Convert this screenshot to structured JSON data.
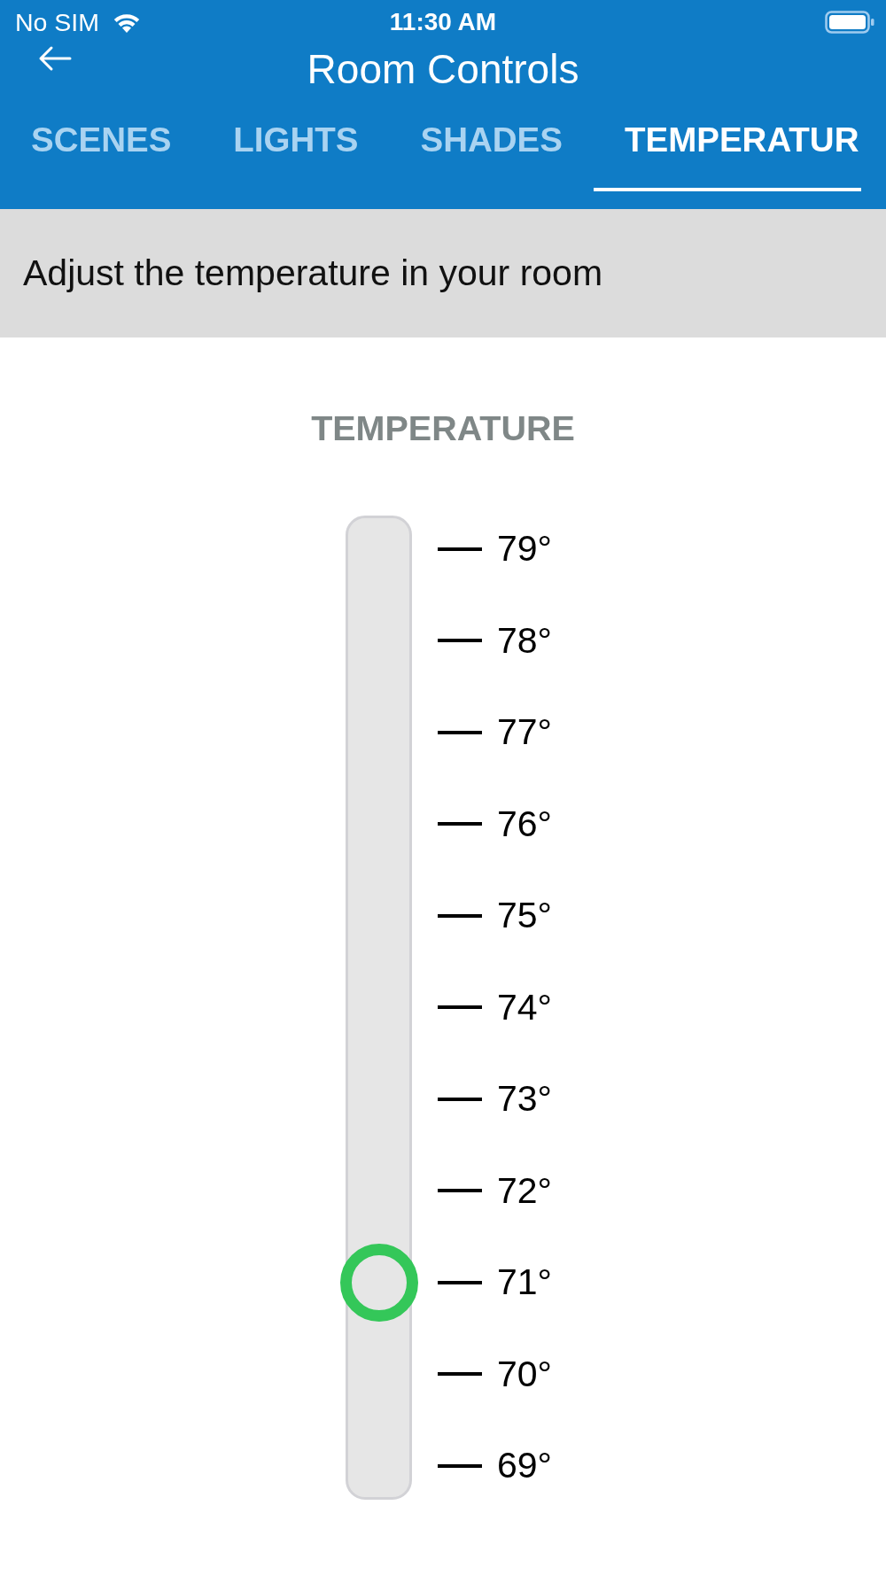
{
  "status_bar": {
    "carrier": "No SIM",
    "time": "11:30 AM"
  },
  "header": {
    "title": "Room Controls"
  },
  "tabs": [
    {
      "label": "SCENES",
      "selected": false
    },
    {
      "label": "LIGHTS",
      "selected": false
    },
    {
      "label": "SHADES",
      "selected": false
    },
    {
      "label": "TEMPERATUR",
      "selected": true
    }
  ],
  "description": "Adjust the temperature in your room",
  "temperature": {
    "heading": "TEMPERATURE",
    "slider": {
      "level": 0.2,
      "ticks": [
        "79°",
        "78°",
        "77°",
        "76°",
        "75°",
        "74°",
        "73°",
        "72°",
        "71°",
        "70°",
        "69°"
      ]
    }
  }
}
